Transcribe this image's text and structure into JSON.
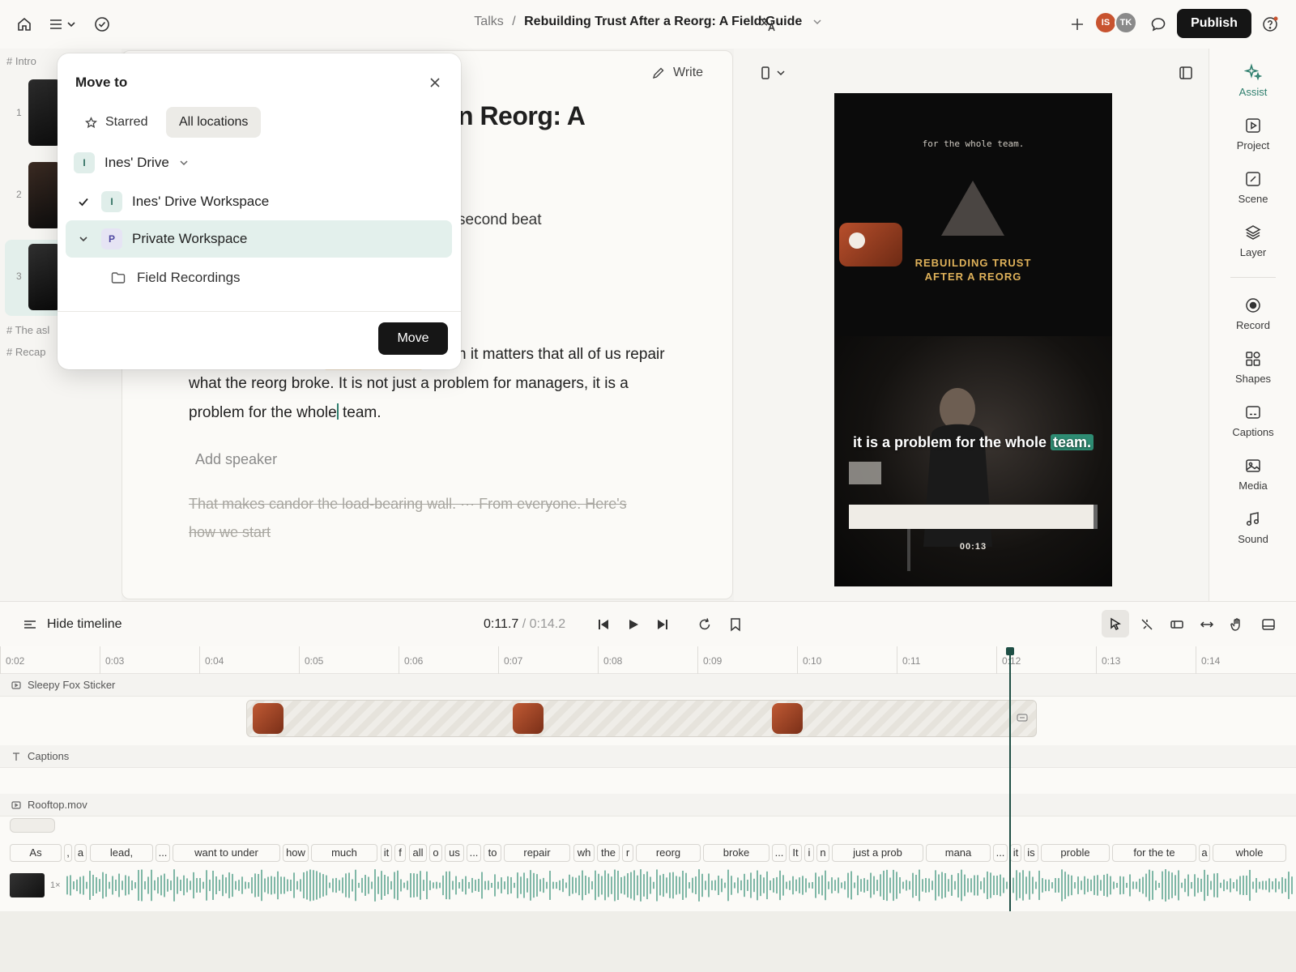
{
  "breadcrumb": {
    "parent": "Talks",
    "separator": "/",
    "title": "Rebuilding Trust After a Reorg: A Field Guide"
  },
  "topbar": {
    "publish_label": "Publish",
    "avatars": [
      "IS",
      "TK"
    ]
  },
  "colors": {
    "accent": "#2f7f6e",
    "avatar_is": "#c8532f",
    "avatar_tk": "#8a8a8a",
    "highlight": "#2e8c73",
    "caption_title": "#e0b25a"
  },
  "scenes": {
    "headings": [
      "Intro",
      "The asl",
      "Recap"
    ],
    "items": [
      {
        "num": "1"
      },
      {
        "num": "2"
      },
      {
        "num": "3"
      }
    ]
  },
  "editor": {
    "write_label": "Write",
    "title_fragment": "n Reorg: A",
    "line_fragment": "second beat",
    "paragraph": {
      "line1": "n it matters that all of us repair",
      "line2": "what the reorg broke. It is not just a problem for managers, it is a",
      "line3_a": "problem for the whole",
      "line3_b": " team."
    },
    "add_speaker": "Add speaker",
    "struck_text_1": "That makes candor the load-bearing wall. ··· From everyone. Here's",
    "struck_text_2": "how we start"
  },
  "preview": {
    "top_caption": "for the whole team.",
    "title_line1": "REBUILDING TRUST",
    "title_line2": "AFTER A REORG",
    "subtitle_main": "it is a problem for the whole",
    "subtitle_highlight": "team.",
    "timecode": "00:13"
  },
  "rail": {
    "items": [
      {
        "label": "Assist",
        "icon": "sparkle-icon"
      },
      {
        "label": "Project",
        "icon": "play-square-icon"
      },
      {
        "label": "Scene",
        "icon": "scene-icon"
      },
      {
        "label": "Layer",
        "icon": "layers-icon"
      },
      {
        "label": "Record",
        "icon": "record-icon"
      },
      {
        "label": "Shapes",
        "icon": "shapes-icon"
      },
      {
        "label": "Captions",
        "icon": "captions-icon"
      },
      {
        "label": "Media",
        "icon": "image-icon"
      },
      {
        "label": "Sound",
        "icon": "music-note-icon"
      }
    ]
  },
  "timeline": {
    "hide_label": "Hide timeline",
    "current_time": "0:11.7",
    "time_sep": " / ",
    "total_time": "0:14.2",
    "ticks": [
      "0:02",
      "0:03",
      "0:04",
      "0:05",
      "0:06",
      "0:07",
      "0:08",
      "0:09",
      "0:10",
      "0:11",
      "0:12",
      "0:13",
      "0:14"
    ],
    "tracks": {
      "sticker": "Sleepy Fox Sticker",
      "captions": "Captions",
      "video": "Rooftop.mov"
    },
    "speed": "1×",
    "words": [
      "As",
      ",",
      "a",
      "lead,",
      "...",
      "want to under",
      "how",
      "much",
      "it",
      "f",
      "all",
      "o",
      "us",
      "...",
      "to",
      "repair",
      "wh",
      "the",
      "r",
      "reorg",
      "broke",
      "...",
      "It",
      "i",
      "n",
      "just a prob",
      "mana",
      "...",
      "it",
      "is",
      "proble",
      "for the te",
      "a",
      "whole"
    ]
  },
  "modal": {
    "title": "Move to",
    "tab_starred": "Starred",
    "tab_all": "All locations",
    "drive_label": "Ines' Drive",
    "drive_chip": "I",
    "rows": [
      {
        "chip": "I",
        "label": "Ines' Drive Workspace"
      },
      {
        "chip": "P",
        "label": "Private Workspace"
      }
    ],
    "folder_label": "Field Recordings",
    "move_label": "Move"
  }
}
